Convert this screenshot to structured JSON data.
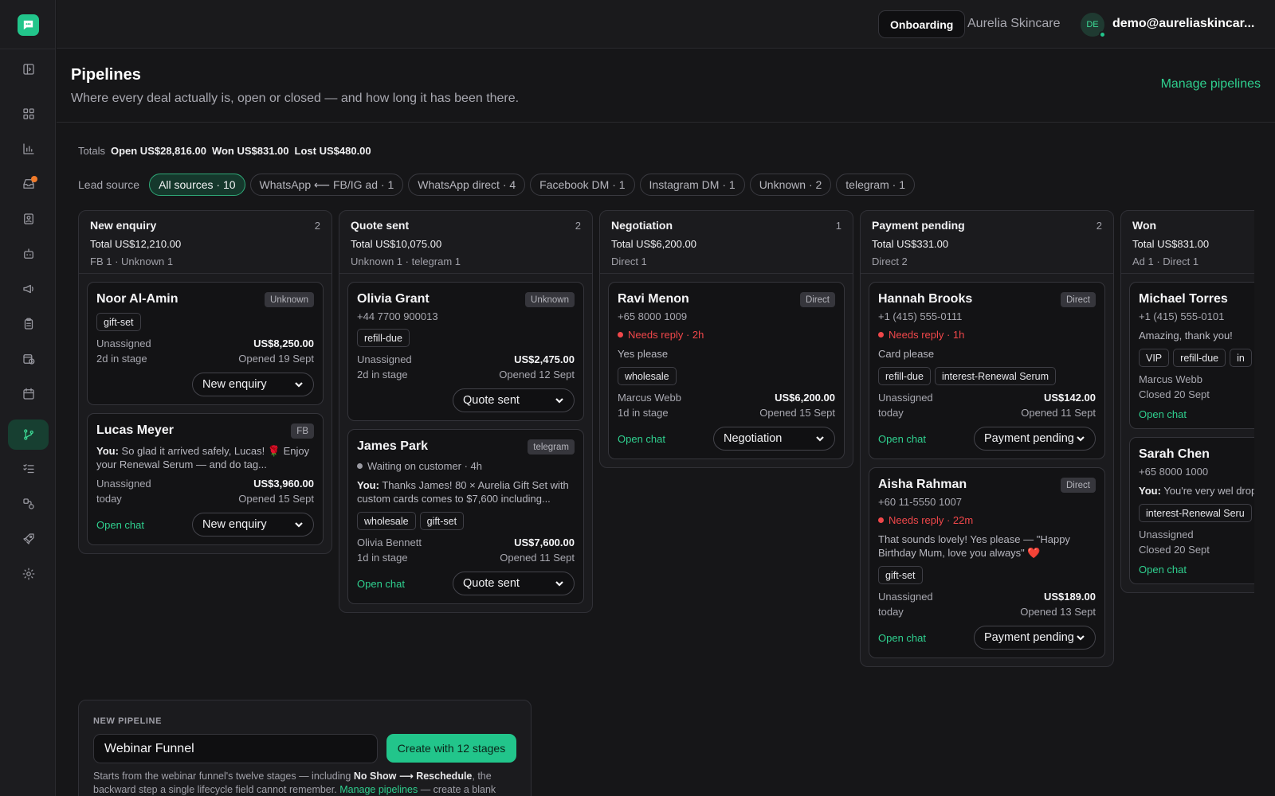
{
  "header": {
    "workspace_button": "Onboarding",
    "org_name": "Aurelia Skincare",
    "avatar_initials": "DE",
    "user_email": "demo@aureliaskincar..."
  },
  "page": {
    "title": "Pipelines",
    "subtitle": "Where every deal actually is, open or closed — and how long it has been there.",
    "manage_link": "Manage pipelines"
  },
  "totals": {
    "label": "Totals",
    "open": "Open US$28,816.00",
    "won": "Won US$831.00",
    "lost": "Lost US$480.00"
  },
  "lead_source": {
    "label": "Lead source",
    "chips": [
      {
        "label": "All sources · 10",
        "active": true
      },
      {
        "label": "WhatsApp ⟵ FB/IG ad · 1",
        "active": false
      },
      {
        "label": "WhatsApp direct · 4",
        "active": false
      },
      {
        "label": "Facebook DM · 1",
        "active": false
      },
      {
        "label": "Instagram DM · 1",
        "active": false
      },
      {
        "label": "Unknown · 2",
        "active": false
      },
      {
        "label": "telegram · 1",
        "active": false
      }
    ]
  },
  "columns": [
    {
      "name": "New enquiry",
      "count": "2",
      "total": "Total US$12,210.00",
      "sources": "FB 1 · Unknown 1",
      "cards": [
        {
          "name": "Noor Al-Amin",
          "badge": "Unknown",
          "tags": [
            "gift-set"
          ],
          "owner": "Unassigned",
          "amount": "US$8,250.00",
          "age": "2d in stage",
          "opened": "Opened 19 Sept",
          "stage": "New enquiry"
        },
        {
          "name": "Lucas Meyer",
          "badge": "FB",
          "msg_prefix": "You:",
          "msg": "So glad it arrived safely, Lucas! 🌹 Enjoy your Renewal Serum — and do tag...",
          "owner": "Unassigned",
          "amount": "US$3,960.00",
          "age": "today",
          "opened": "Opened 15 Sept",
          "open_chat": "Open chat",
          "stage": "New enquiry"
        }
      ]
    },
    {
      "name": "Quote sent",
      "count": "2",
      "total": "Total US$10,075.00",
      "sources": "Unknown 1 · telegram 1",
      "cards": [
        {
          "name": "Olivia Grant",
          "badge": "Unknown",
          "phone": "+44 7700 900013",
          "tags": [
            "refill-due"
          ],
          "owner": "Unassigned",
          "amount": "US$2,475.00",
          "age": "2d in stage",
          "opened": "Opened 12 Sept",
          "stage": "Quote sent"
        },
        {
          "name": "James Park",
          "badge": "telegram",
          "status": "Waiting on customer · 4h",
          "status_kind": "grey",
          "msg_prefix": "You:",
          "msg": "Thanks James! 80 × Aurelia Gift Set with custom cards comes to $7,600 including...",
          "tags": [
            "wholesale",
            "gift-set"
          ],
          "owner": "Olivia Bennett",
          "amount": "US$7,600.00",
          "age": "1d in stage",
          "opened": "Opened 11 Sept",
          "open_chat": "Open chat",
          "stage": "Quote sent"
        }
      ]
    },
    {
      "name": "Negotiation",
      "count": "1",
      "total": "Total US$6,200.00",
      "sources": "Direct 1",
      "cards": [
        {
          "name": "Ravi Menon",
          "badge": "Direct",
          "phone": "+65 8000 1009",
          "status": "Needs reply · 2h",
          "status_kind": "red",
          "msg": "Yes please",
          "tags": [
            "wholesale"
          ],
          "owner": "Marcus Webb",
          "amount": "US$6,200.00",
          "age": "1d in stage",
          "opened": "Opened 15 Sept",
          "open_chat": "Open chat",
          "stage": "Negotiation"
        }
      ]
    },
    {
      "name": "Payment pending",
      "count": "2",
      "total": "Total US$331.00",
      "sources": "Direct 2",
      "cards": [
        {
          "name": "Hannah Brooks",
          "badge": "Direct",
          "phone": "+1 (415) 555-0111",
          "status": "Needs reply · 1h",
          "status_kind": "red",
          "msg": "Card please",
          "tags": [
            "refill-due",
            "interest-Renewal Serum"
          ],
          "owner": "Unassigned",
          "amount": "US$142.00",
          "age": "today",
          "opened": "Opened 11 Sept",
          "open_chat": "Open chat",
          "stage": "Payment pending"
        },
        {
          "name": "Aisha Rahman",
          "badge": "Direct",
          "phone": "+60 11-5550 1007",
          "status": "Needs reply · 22m",
          "status_kind": "red",
          "msg": "That sounds lovely! Yes please — \"Happy Birthday Mum, love you always\" ❤️",
          "tags": [
            "gift-set"
          ],
          "owner": "Unassigned",
          "amount": "US$189.00",
          "age": "today",
          "opened": "Opened 13 Sept",
          "open_chat": "Open chat",
          "stage": "Payment pending"
        }
      ]
    },
    {
      "name": "Won",
      "count": "",
      "total": "Total US$831.00",
      "sources": "Ad 1 · Direct 1",
      "cards": [
        {
          "name": "Michael Torres",
          "badge": "",
          "phone": "+1 (415) 555-0101",
          "msg": "Amazing, thank you!",
          "tags": [
            "VIP",
            "refill-due",
            "in"
          ],
          "owner": "Marcus Webb",
          "amount": "",
          "age": "Closed 20 Sept",
          "opened": "",
          "open_chat": "Open chat",
          "stage": ""
        },
        {
          "name": "Sarah Chen",
          "badge": "",
          "phone": "+65 8000 1000",
          "msg_prefix": "You:",
          "msg": "You're very wel drops after your tone",
          "tags": [
            "interest-Renewal Seru"
          ],
          "owner": "Unassigned",
          "amount": "",
          "age": "Closed 20 Sept",
          "opened": "",
          "open_chat": "Open chat",
          "stage": ""
        }
      ]
    }
  ],
  "new_pipeline": {
    "label": "NEW PIPELINE",
    "input_value": "Webinar Funnel",
    "button": "Create with 12 stages",
    "desc_1": "Starts from the webinar funnel's twelve stages — including",
    "desc_bold": "No Show ⟶ Reschedule",
    "desc_2": ", the backward step a single lifecycle field cannot remember.",
    "desc_link": "Manage pipelines",
    "desc_3": "— create a blank"
  },
  "colors": {
    "accent": "#22c58b",
    "link": "#2fd08f",
    "danger": "#f0474a",
    "notify": "#f07a2a"
  },
  "icons": [
    "chat-logo-icon",
    "sidebar-toggle-icon",
    "dashboard-icon",
    "analytics-icon",
    "inbox-icon",
    "contacts-icon",
    "bot-icon",
    "megaphone-icon",
    "clipboard-icon",
    "schedule-icon",
    "calendar-icon",
    "pipeline-icon",
    "checklist-icon",
    "integrations-icon",
    "rocket-icon",
    "gear-icon"
  ]
}
